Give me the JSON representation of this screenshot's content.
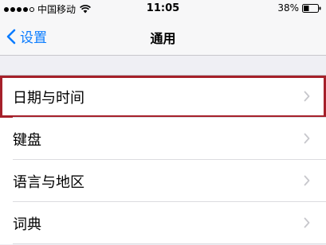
{
  "status_bar": {
    "signal_dots": [
      true,
      true,
      true,
      true,
      false
    ],
    "carrier": "中国移动",
    "time": "11:05",
    "battery_percent": "38%",
    "battery_level": 0.38
  },
  "nav": {
    "back_label": "设置",
    "title": "通用"
  },
  "list": {
    "items": [
      {
        "label": "日期与时间",
        "highlighted": true
      },
      {
        "label": "键盘",
        "highlighted": false
      },
      {
        "label": "语言与地区",
        "highlighted": false
      },
      {
        "label": "词典",
        "highlighted": false
      }
    ]
  },
  "colors": {
    "accent": "#0a7cff",
    "highlight_border": "#a5202a",
    "background": "#efeff4"
  }
}
